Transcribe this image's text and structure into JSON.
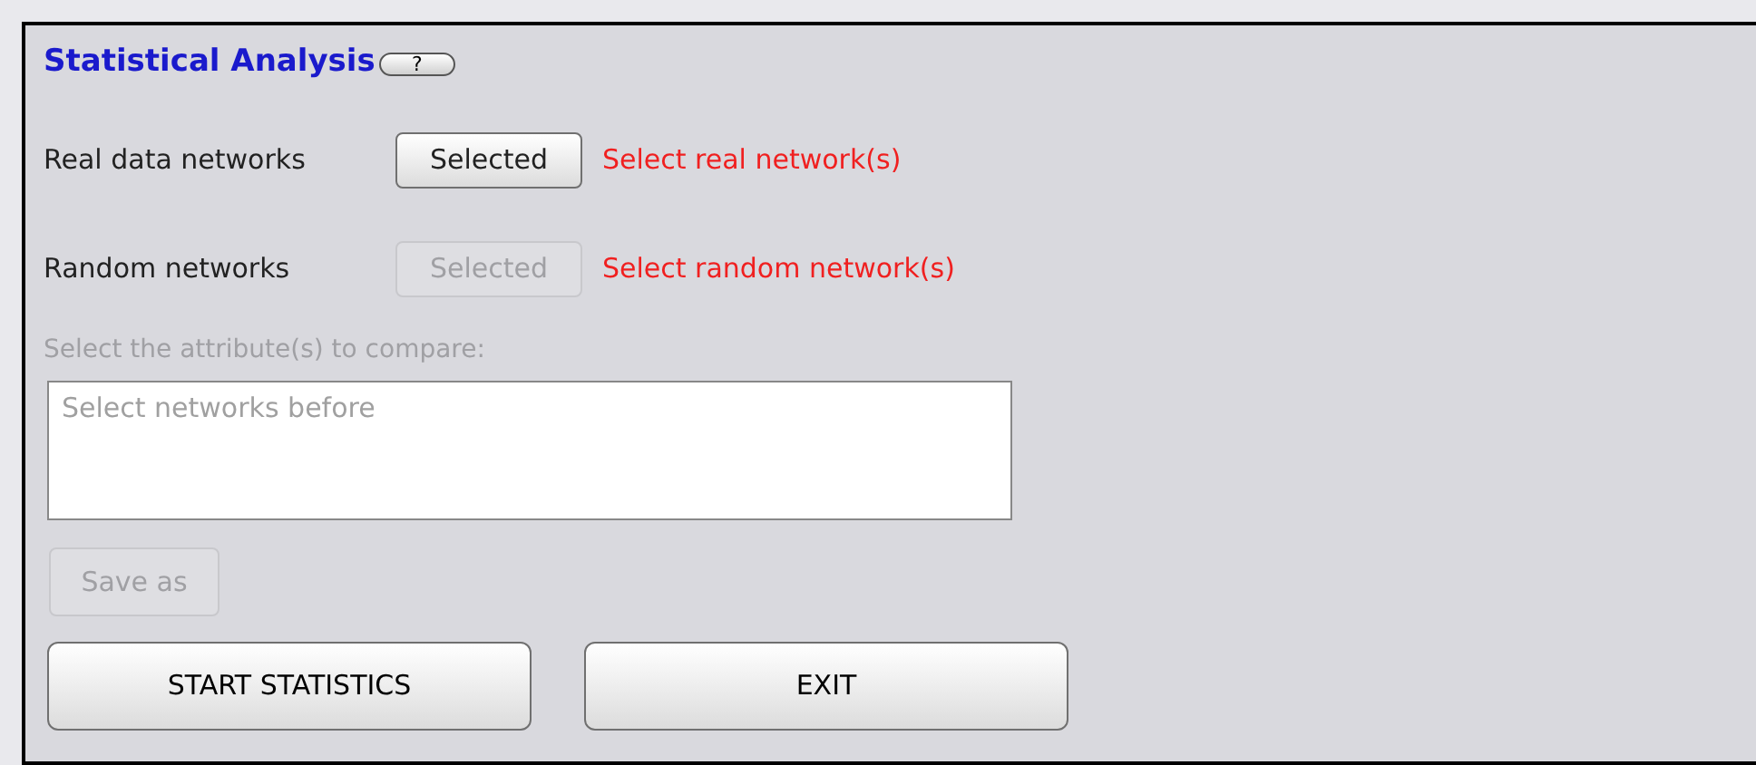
{
  "title": "Statistical Analysis",
  "help_button": "?",
  "network_rows": [
    {
      "label": "Real data networks",
      "button": "Selected",
      "disabled": false,
      "status": "Select real network(s)"
    },
    {
      "label": "Random networks",
      "button": "Selected",
      "disabled": true,
      "status": "Select random network(s)"
    }
  ],
  "attributes": {
    "label": "Select the attribute(s) to compare:",
    "disabled": true,
    "placeholder": "Select networks before"
  },
  "save_button": {
    "label": "Save as",
    "disabled": true
  },
  "actions": [
    "START STATISTICS",
    "EXIT"
  ]
}
